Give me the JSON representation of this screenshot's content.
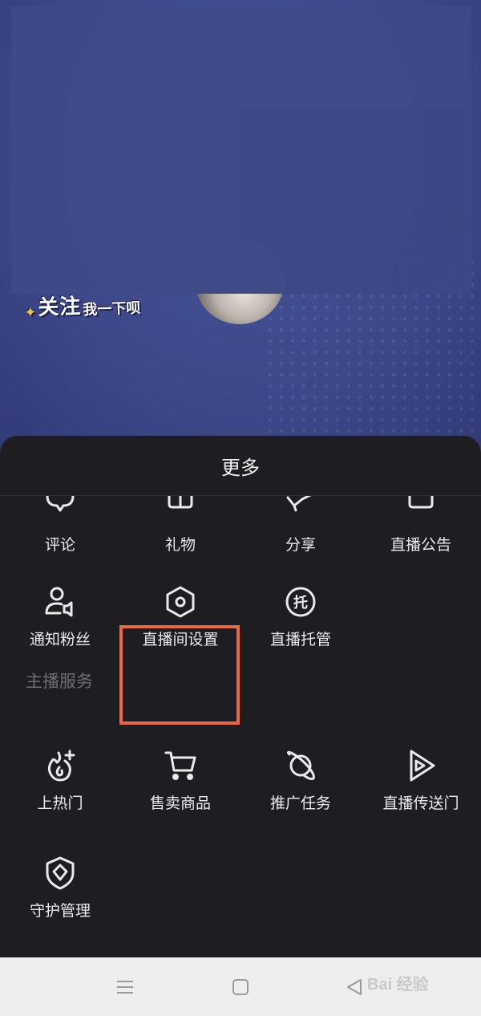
{
  "background": {
    "sticker": {
      "main": "关注",
      "tail": "我一下呗"
    }
  },
  "sheet": {
    "title": "更多",
    "section_label": "主播服务",
    "top_items": [
      {
        "label": "评论",
        "icon": "comment-icon"
      },
      {
        "label": "礼物",
        "icon": "gift-icon"
      },
      {
        "label": "分享",
        "icon": "share-icon"
      },
      {
        "label": "直播公告",
        "icon": "announcement-icon"
      }
    ],
    "row2_items": [
      {
        "label": "通知粉丝",
        "icon": "notify-fans-icon"
      },
      {
        "label": "直播间设置",
        "icon": "settings-hexagon-icon"
      },
      {
        "label": "直播托管",
        "icon": "hosting-icon",
        "glyph": "托"
      }
    ],
    "service_items": [
      {
        "label": "上热门",
        "icon": "hot-boost-icon"
      },
      {
        "label": "售卖商品",
        "icon": "cart-icon"
      },
      {
        "label": "推广任务",
        "icon": "planet-icon"
      },
      {
        "label": "直播传送门",
        "icon": "portal-play-icon"
      },
      {
        "label": "守护管理",
        "icon": "shield-icon"
      }
    ],
    "highlight_color": "#f0683a"
  },
  "navbar": {
    "buttons": [
      "menu-icon",
      "home-square-icon",
      "back-triangle-icon"
    ],
    "watermark": "Bai 经验"
  }
}
